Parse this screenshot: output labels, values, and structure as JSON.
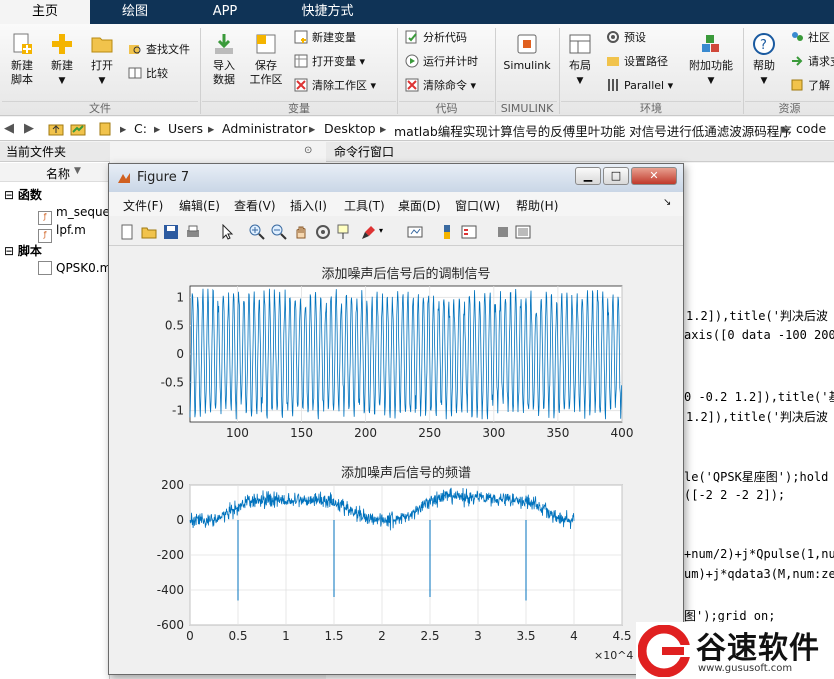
{
  "tabs": [
    "主页",
    "绘图",
    "APP",
    "快捷方式"
  ],
  "ribbon": {
    "file": {
      "new_script": "新建\n脚本",
      "new": "新建",
      "open": "打开",
      "find_files": "查找文件",
      "compare": "比较",
      "section": "文件"
    },
    "variable": {
      "import": "导入\n数据",
      "save_ws": "保存\n工作区",
      "new_var": "新建变量",
      "open_var": "打开变量",
      "clear_ws": "清除工作区",
      "section": "变量"
    },
    "code": {
      "analyze": "分析代码",
      "run_time": "运行并计时",
      "clear_cmd": "清除命令",
      "section": "代码"
    },
    "simulink": {
      "label": "Simulink",
      "section": "SIMULINK"
    },
    "env": {
      "layout": "布局",
      "prefs": "预设",
      "set_path": "设置路径",
      "parallel": "Parallel",
      "addons": "附加功能",
      "section": "环境"
    },
    "help": {
      "help": "帮助",
      "community": "社区",
      "request": "请求支",
      "learn": "了解",
      "section": "资源"
    }
  },
  "address": [
    "C:",
    "Users",
    "Administrator",
    "Desktop",
    "matlab编程实现计算信号的反傅里叶功能 对信号进行低通滤波源码程序",
    "code"
  ],
  "left_panel": {
    "title": "当前文件夹",
    "col_name": "名称",
    "groups": [
      {
        "label": "函数",
        "files": [
          "m_seque",
          "lpf.m"
        ]
      },
      {
        "label": "脚本",
        "files": [
          "QPSK0.m"
        ]
      }
    ]
  },
  "command_window": {
    "title": "命令行窗口",
    "lines": [
      "1.2]),title('判决后波",
      "axis([0 data -100 200]",
      "0 -0.2 1.2]),title('基",
      "1.2]),title('判决后波",
      "le('QPSK星座图');hold o",
      "([-2 2 -2 2]);",
      "+num/2)+j*Qpulse(1,num",
      "um)+j*qdata3(M,num:zer",
      "图');grid on;"
    ]
  },
  "figure": {
    "title": "Figure 7",
    "menu": [
      "文件(F)",
      "编辑(E)",
      "查看(V)",
      "插入(I)",
      "工具(T)",
      "桌面(D)",
      "窗口(W)",
      "帮助(H)"
    ]
  },
  "chart_data": [
    {
      "type": "line",
      "title": "添加噪声后信号后的调制信号",
      "xlabel": "",
      "ylabel": "",
      "xlim": [
        63,
        400
      ],
      "ylim": [
        -1.2,
        1.2
      ],
      "xticks": [
        100,
        150,
        200,
        250,
        300,
        350,
        400
      ],
      "yticks": [
        -1,
        -0.5,
        0,
        0.5,
        1
      ],
      "grid": true,
      "color": "#0072bd",
      "signal": {
        "cycle_period": 4,
        "amplitude": 1.05,
        "noise": 0.12
      }
    },
    {
      "type": "line",
      "title": "添加噪声后信号的频谱",
      "xlabel": "",
      "ylabel": "",
      "xlim": [
        0,
        45000
      ],
      "ylim": [
        -600,
        200
      ],
      "xticks": [
        0,
        0.5,
        1,
        1.5,
        2,
        2.5,
        3,
        3.5,
        4,
        4.5
      ],
      "xtick_multiplier": "×10^4",
      "yticks": [
        -600,
        -400,
        -200,
        0,
        200
      ],
      "grid": true,
      "color": "#0072bd",
      "data_range": [
        0,
        40000
      ],
      "envelope": {
        "x": [
          0,
          2500,
          5000,
          6000,
          8000,
          10000,
          13000,
          15000,
          17000,
          19000,
          21000,
          23000,
          25000,
          27000,
          29000,
          31000,
          33000,
          35000,
          37000,
          38500,
          40000
        ],
        "y": [
          0,
          0,
          60,
          110,
          120,
          110,
          115,
          110,
          40,
          10,
          0,
          30,
          110,
          135,
          130,
          130,
          120,
          110,
          60,
          0,
          -5
        ]
      },
      "spikes": [
        {
          "x": 5000,
          "y": -460
        },
        {
          "x": 15000,
          "y": -440
        },
        {
          "x": 25000,
          "y": -440
        },
        {
          "x": 35000,
          "y": -460
        }
      ]
    }
  ],
  "logo": {
    "text": "谷速软件",
    "url": "www.gususoft.com"
  }
}
